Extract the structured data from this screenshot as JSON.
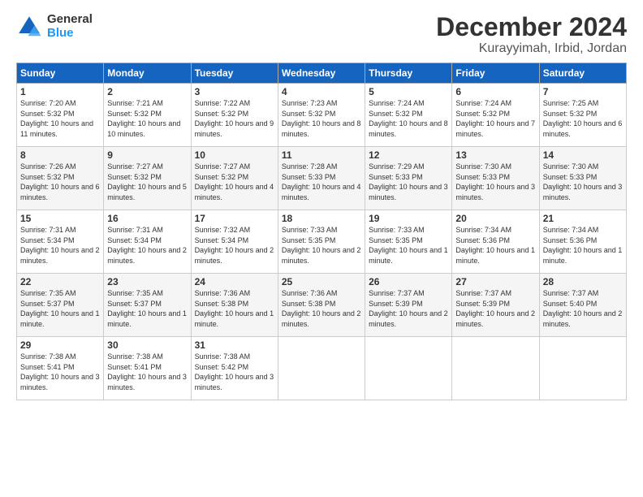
{
  "logo": {
    "general": "General",
    "blue": "Blue"
  },
  "title": "December 2024",
  "subtitle": "Kurayyimah, Irbid, Jordan",
  "weekdays": [
    "Sunday",
    "Monday",
    "Tuesday",
    "Wednesday",
    "Thursday",
    "Friday",
    "Saturday"
  ],
  "weeks": [
    [
      {
        "day": "1",
        "sunrise": "7:20 AM",
        "sunset": "5:32 PM",
        "daylight": "10 hours and 11 minutes."
      },
      {
        "day": "2",
        "sunrise": "7:21 AM",
        "sunset": "5:32 PM",
        "daylight": "10 hours and 10 minutes."
      },
      {
        "day": "3",
        "sunrise": "7:22 AM",
        "sunset": "5:32 PM",
        "daylight": "10 hours and 9 minutes."
      },
      {
        "day": "4",
        "sunrise": "7:23 AM",
        "sunset": "5:32 PM",
        "daylight": "10 hours and 8 minutes."
      },
      {
        "day": "5",
        "sunrise": "7:24 AM",
        "sunset": "5:32 PM",
        "daylight": "10 hours and 8 minutes."
      },
      {
        "day": "6",
        "sunrise": "7:24 AM",
        "sunset": "5:32 PM",
        "daylight": "10 hours and 7 minutes."
      },
      {
        "day": "7",
        "sunrise": "7:25 AM",
        "sunset": "5:32 PM",
        "daylight": "10 hours and 6 minutes."
      }
    ],
    [
      {
        "day": "8",
        "sunrise": "7:26 AM",
        "sunset": "5:32 PM",
        "daylight": "10 hours and 6 minutes."
      },
      {
        "day": "9",
        "sunrise": "7:27 AM",
        "sunset": "5:32 PM",
        "daylight": "10 hours and 5 minutes."
      },
      {
        "day": "10",
        "sunrise": "7:27 AM",
        "sunset": "5:32 PM",
        "daylight": "10 hours and 4 minutes."
      },
      {
        "day": "11",
        "sunrise": "7:28 AM",
        "sunset": "5:33 PM",
        "daylight": "10 hours and 4 minutes."
      },
      {
        "day": "12",
        "sunrise": "7:29 AM",
        "sunset": "5:33 PM",
        "daylight": "10 hours and 3 minutes."
      },
      {
        "day": "13",
        "sunrise": "7:30 AM",
        "sunset": "5:33 PM",
        "daylight": "10 hours and 3 minutes."
      },
      {
        "day": "14",
        "sunrise": "7:30 AM",
        "sunset": "5:33 PM",
        "daylight": "10 hours and 3 minutes."
      }
    ],
    [
      {
        "day": "15",
        "sunrise": "7:31 AM",
        "sunset": "5:34 PM",
        "daylight": "10 hours and 2 minutes."
      },
      {
        "day": "16",
        "sunrise": "7:31 AM",
        "sunset": "5:34 PM",
        "daylight": "10 hours and 2 minutes."
      },
      {
        "day": "17",
        "sunrise": "7:32 AM",
        "sunset": "5:34 PM",
        "daylight": "10 hours and 2 minutes."
      },
      {
        "day": "18",
        "sunrise": "7:33 AM",
        "sunset": "5:35 PM",
        "daylight": "10 hours and 2 minutes."
      },
      {
        "day": "19",
        "sunrise": "7:33 AM",
        "sunset": "5:35 PM",
        "daylight": "10 hours and 1 minute."
      },
      {
        "day": "20",
        "sunrise": "7:34 AM",
        "sunset": "5:36 PM",
        "daylight": "10 hours and 1 minute."
      },
      {
        "day": "21",
        "sunrise": "7:34 AM",
        "sunset": "5:36 PM",
        "daylight": "10 hours and 1 minute."
      }
    ],
    [
      {
        "day": "22",
        "sunrise": "7:35 AM",
        "sunset": "5:37 PM",
        "daylight": "10 hours and 1 minute."
      },
      {
        "day": "23",
        "sunrise": "7:35 AM",
        "sunset": "5:37 PM",
        "daylight": "10 hours and 1 minute."
      },
      {
        "day": "24",
        "sunrise": "7:36 AM",
        "sunset": "5:38 PM",
        "daylight": "10 hours and 1 minute."
      },
      {
        "day": "25",
        "sunrise": "7:36 AM",
        "sunset": "5:38 PM",
        "daylight": "10 hours and 2 minutes."
      },
      {
        "day": "26",
        "sunrise": "7:37 AM",
        "sunset": "5:39 PM",
        "daylight": "10 hours and 2 minutes."
      },
      {
        "day": "27",
        "sunrise": "7:37 AM",
        "sunset": "5:39 PM",
        "daylight": "10 hours and 2 minutes."
      },
      {
        "day": "28",
        "sunrise": "7:37 AM",
        "sunset": "5:40 PM",
        "daylight": "10 hours and 2 minutes."
      }
    ],
    [
      {
        "day": "29",
        "sunrise": "7:38 AM",
        "sunset": "5:41 PM",
        "daylight": "10 hours and 3 minutes."
      },
      {
        "day": "30",
        "sunrise": "7:38 AM",
        "sunset": "5:41 PM",
        "daylight": "10 hours and 3 minutes."
      },
      {
        "day": "31",
        "sunrise": "7:38 AM",
        "sunset": "5:42 PM",
        "daylight": "10 hours and 3 minutes."
      },
      null,
      null,
      null,
      null
    ]
  ]
}
